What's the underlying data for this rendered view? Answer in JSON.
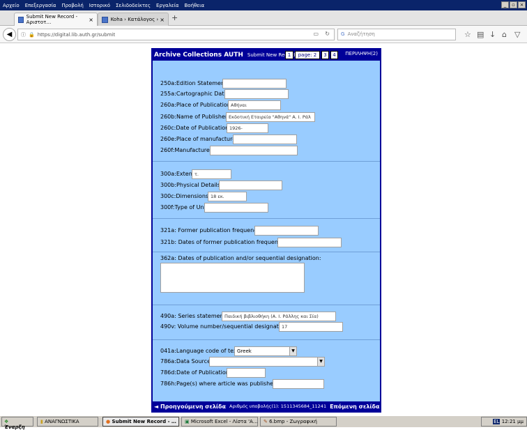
{
  "menubar": {
    "items": [
      "Αρχείο",
      "Επεξεργασία",
      "Προβολή",
      "Ιστορικό",
      "Σελιδοδείκτες",
      "Εργαλεία",
      "Βοήθεια"
    ]
  },
  "tabs": [
    {
      "label": "Submit New Record - Αριστοτ…"
    },
    {
      "label": "Koha › Κατάλογος › Προβολή …"
    }
  ],
  "address": {
    "url": "https://digital.lib.auth.gr/submit",
    "search_placeholder": "Αναζήτηση"
  },
  "form": {
    "site_title": "Archive Collections AUTH",
    "subtitle": "Submit New Record",
    "pages": [
      "1",
      "page: 2",
      "3",
      "4"
    ],
    "summary_link": "ΠΕΡΙΛΗΨΗ(2)",
    "fields": {
      "f250a": {
        "label": "250a:Edition Statement:",
        "value": ""
      },
      "f255a": {
        "label": "255a:Cartographic Data:",
        "value": ""
      },
      "f260a": {
        "label": "260a:Place of Publication:",
        "value": "Αθήναι"
      },
      "f260b": {
        "label": "260b:Name of Publisher:",
        "value": "Εκδοτική Εταιρεία \"Αθηνά\" Α. Ι. Ράλ"
      },
      "f260c": {
        "label": "260c:Date of Publication:",
        "value": "1926-"
      },
      "f260e": {
        "label": "260e:Place of manufacture:",
        "value": ""
      },
      "f260f": {
        "label": "260f:Manufacturer:",
        "value": ""
      },
      "f300a": {
        "label": "300a:Extent:",
        "value": "τ."
      },
      "f300b": {
        "label": "300b:Physical Details:",
        "value": ""
      },
      "f300c": {
        "label": "300c:Dimensions:",
        "value": "18 εκ."
      },
      "f300f": {
        "label": "300f:Type of Unit:",
        "value": ""
      },
      "f321a": {
        "label": "321a: Former publication frequency:",
        "value": ""
      },
      "f321b": {
        "label": "321b: Dates of former publication frequency:",
        "value": ""
      },
      "f362a": {
        "label": "362a: Dates of publication and/or sequential designation:",
        "value": ""
      },
      "f490a": {
        "label": "490a: Series statement:",
        "value": "Παιδική βιβλιοθήκη (Α. Ι. Ράλλης και Σία)"
      },
      "f490v": {
        "label": "490v: Volume number/sequential designation:",
        "value": "17"
      },
      "f041a": {
        "label": "041a:Language code of text:",
        "value": "Greek"
      },
      "f786a": {
        "label": "786a:Data Source:",
        "value": ""
      },
      "f786d": {
        "label": "786d:Date of Publication:",
        "value": ""
      },
      "f786h": {
        "label": "786h:Page(s) where article was published:",
        "value": ""
      }
    },
    "footer": {
      "prev": "◄ Προηγούμενη σελίδα",
      "submission_id": "Αριθμός υποβολής(1): 1511345684_11241",
      "next": "Επόμενη σελίδα ►"
    }
  },
  "taskbar": {
    "start": "Έναρξη",
    "tasks": [
      "ΑΝΑΓΝΩΣΤΙΚΑ",
      "Submit New Record - …",
      "Microsoft Excel - Λίστα 'Α…",
      "6.bmp - Ζωγραφική"
    ],
    "clock": "12:21 μμ"
  }
}
